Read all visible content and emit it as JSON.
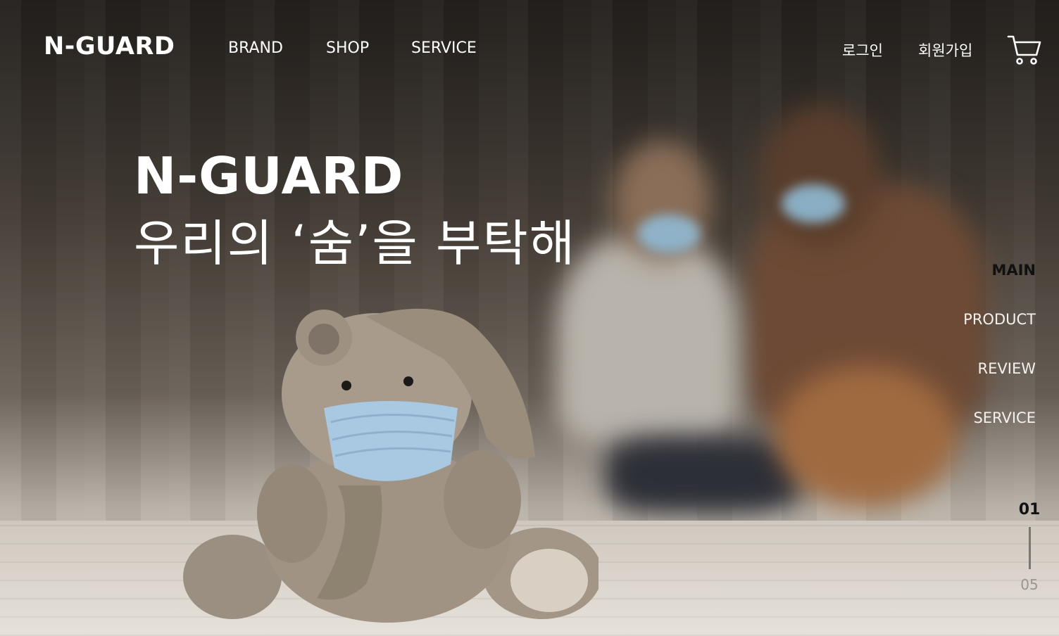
{
  "brand": {
    "logo": "N-GUARD"
  },
  "nav": {
    "items": [
      {
        "label": "BRAND"
      },
      {
        "label": "SHOP"
      },
      {
        "label": "SERVICE"
      }
    ],
    "login_label": "로그인",
    "signup_label": "회원가입",
    "cart_icon": "cart-icon"
  },
  "hero": {
    "title": "N-GUARD",
    "subtitle": "우리의 ‘숨’을 부탁해"
  },
  "side_nav": {
    "items": [
      {
        "label": "MAIN",
        "active": true
      },
      {
        "label": "PRODUCT",
        "active": false
      },
      {
        "label": "REVIEW",
        "active": false
      },
      {
        "label": "SERVICE",
        "active": false
      }
    ]
  },
  "pager": {
    "current": "01",
    "total": "05"
  },
  "colors": {
    "text_light": "#ffffff",
    "active_dark": "#111111",
    "muted": "#9a9590"
  }
}
